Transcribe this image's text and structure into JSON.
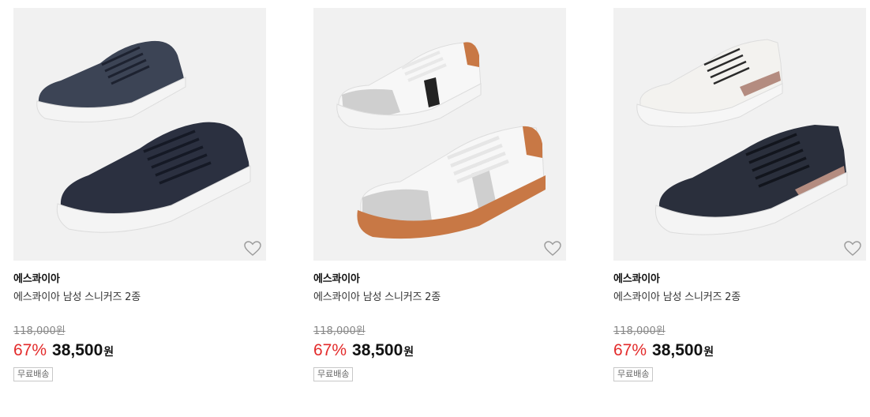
{
  "products": [
    {
      "brand": "에스콰이아",
      "title": "에스콰이아 남성 스니커즈 2종",
      "original_price": "118,000원",
      "discount_rate": "67%",
      "sale_price": "38,500",
      "currency": "원",
      "badge": "무료배송",
      "colors": {
        "upper_back": "#3c4455",
        "upper_front": "#2b3040",
        "sole": "#f4f4f4"
      }
    },
    {
      "brand": "에스콰이아",
      "title": "에스콰이아 남성 스니커즈 2종",
      "original_price": "118,000원",
      "discount_rate": "67%",
      "sale_price": "38,500",
      "currency": "원",
      "badge": "무료배송",
      "colors": {
        "upper_back": "#f7f7f7",
        "upper_front": "#f7f7f7",
        "sole": "#c87845"
      }
    },
    {
      "brand": "에스콰이아",
      "title": "에스콰이아 남성 스니커즈 2종",
      "original_price": "118,000원",
      "discount_rate": "67%",
      "sale_price": "38,500",
      "currency": "원",
      "badge": "무료배송",
      "colors": {
        "upper_back": "#f3f2ef",
        "upper_front": "#2a2f3c",
        "sole": "#f4f4f4"
      }
    }
  ],
  "icons": {
    "wishlist": "heart-outline-icon"
  },
  "accent": {
    "discount": "#e32b2b"
  }
}
